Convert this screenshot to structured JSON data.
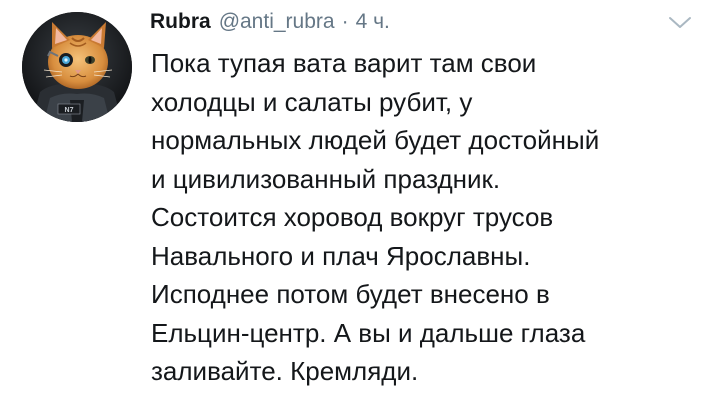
{
  "tweet": {
    "author_name": "Rubra",
    "handle": "@anti_rubra",
    "separator": "·",
    "time": "4 ч.",
    "text_lines": [
      "Пока тупая вата варит там свои",
      "холодцы и салаты рубит, у",
      "нормальных людей будет достойный",
      "и цивилизованный праздник.",
      "Состоится хоровод вокруг трусов",
      "Навального и плач Ярославны.",
      "Исподнее потом будет внесено в",
      "Ельцин-центр. А вы и дальше глаза",
      "заливайте. Кремляди."
    ],
    "avatar_badge": "N7"
  },
  "colors": {
    "text": "#14171a",
    "secondary": "#657786",
    "caret": "#aab8c2",
    "background": "#ffffff"
  },
  "icons": {
    "caret": "chevron-down-icon",
    "avatar": "cat-avatar"
  }
}
